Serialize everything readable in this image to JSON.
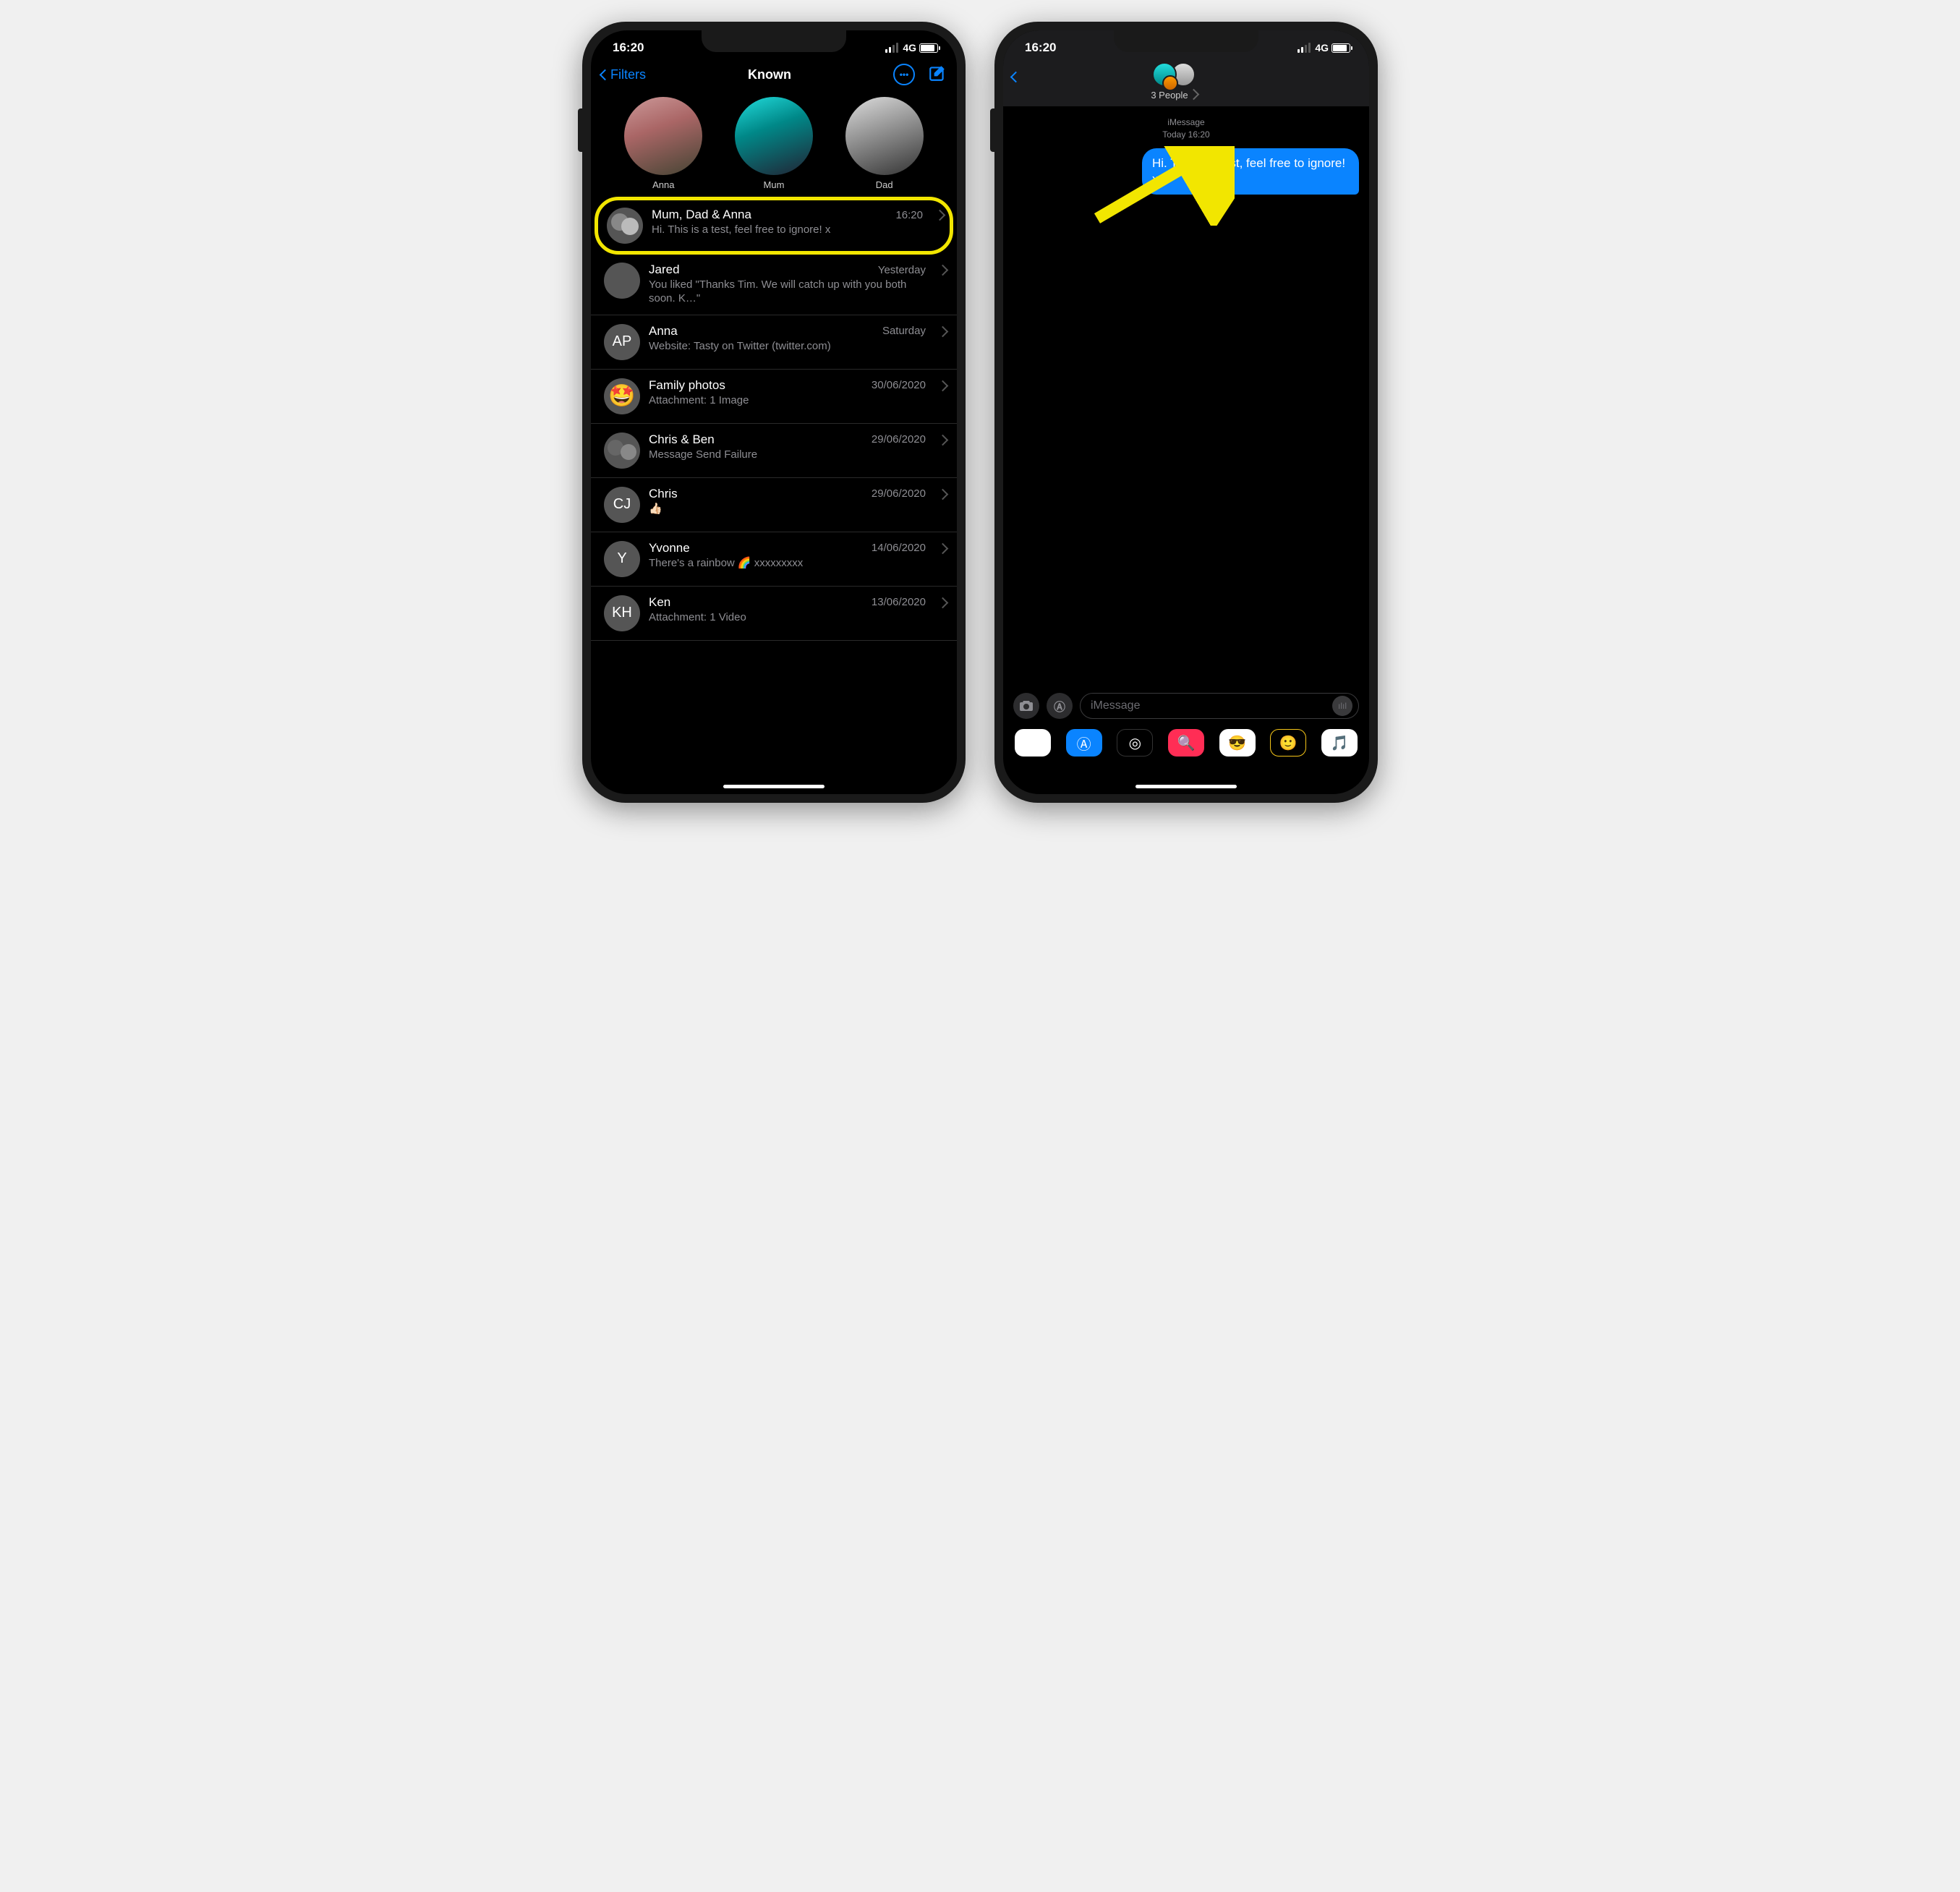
{
  "status": {
    "time": "16:20",
    "network": "4G"
  },
  "left": {
    "nav": {
      "back": "Filters",
      "title": "Known"
    },
    "pinned": [
      {
        "name": "Anna"
      },
      {
        "name": "Mum"
      },
      {
        "name": "Dad"
      }
    ],
    "conversations": [
      {
        "name": "Mum, Dad & Anna",
        "time": "16:20",
        "preview": "Hi. This is a test, feel free to ignore! x"
      },
      {
        "name": "Jared",
        "time": "Yesterday",
        "preview": "You liked \"Thanks Tim. We will catch up with you both soon. K…\""
      },
      {
        "name": "Anna",
        "time": "Saturday",
        "preview": "Website: Tasty on Twitter (twitter.com)",
        "initials": "AP"
      },
      {
        "name": "Family photos",
        "time": "30/06/2020",
        "preview": "Attachment: 1 Image"
      },
      {
        "name": "Chris & Ben",
        "time": "29/06/2020",
        "preview": "Message Send Failure"
      },
      {
        "name": "Chris",
        "time": "29/06/2020",
        "preview": "👍🏻",
        "initials": "CJ"
      },
      {
        "name": "Yvonne",
        "time": "14/06/2020",
        "preview": "There's a rainbow 🌈 xxxxxxxxx",
        "initials": "Y"
      },
      {
        "name": "Ken",
        "time": "13/06/2020",
        "preview": "Attachment: 1 Video",
        "initials": "KH"
      }
    ]
  },
  "right": {
    "header": {
      "title": "3 People"
    },
    "meta": {
      "service": "iMessage",
      "ts": "Today 16:20"
    },
    "bubble": "Hi. This is a test, feel free to ignore! x",
    "input_placeholder": "iMessage"
  }
}
